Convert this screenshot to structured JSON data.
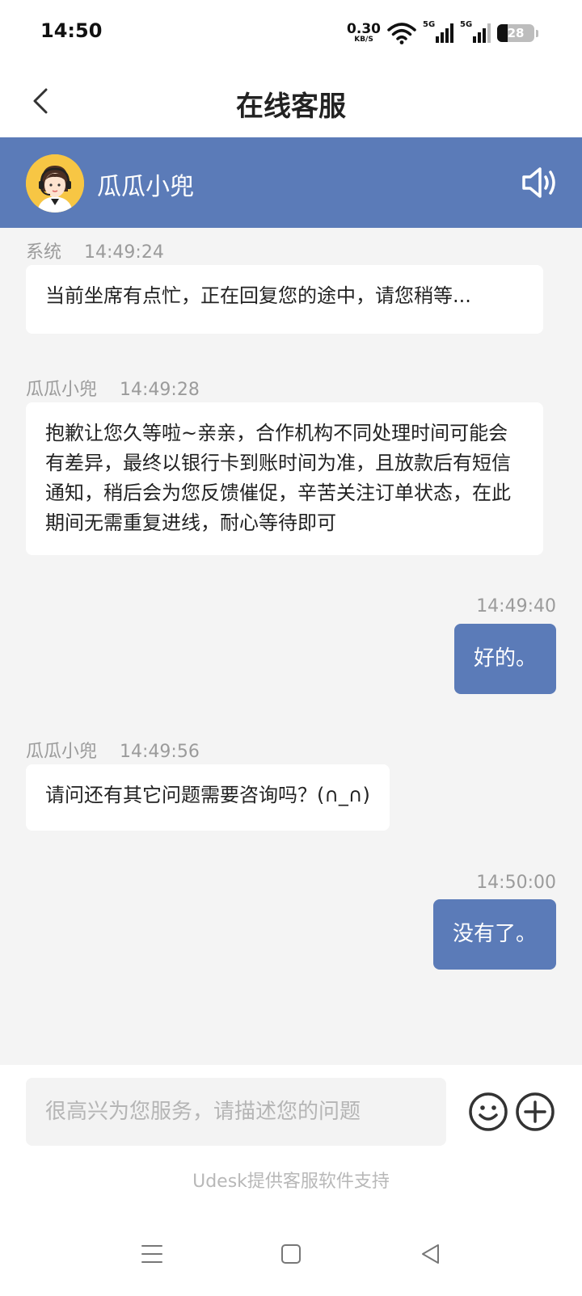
{
  "status_bar": {
    "time": "14:50",
    "net_speed_value": "0.30",
    "net_speed_unit": "KB/S",
    "signal_1_label": "5G",
    "signal_2_label": "5G",
    "battery_level": "28"
  },
  "nav": {
    "title": "在线客服",
    "back_icon": "chevron-left-icon"
  },
  "agent": {
    "name": "瓜瓜小兜",
    "avatar_icon": "agent-avatar",
    "speaker_icon": "speaker-icon"
  },
  "messages": [
    {
      "sender": "系统",
      "time": "14:49:24",
      "text": "当前坐席有点忙，正在回复您的途中，请您稍等..."
    },
    {
      "sender": "瓜瓜小兜",
      "time": "14:49:28",
      "text": "抱歉让您久等啦~亲亲，合作机构不同处理时间可能会有差异，最终以银行卡到账时间为准，且放款后有短信通知，稍后会为您反馈催促，辛苦关注订单状态，在此期间无需重复进线，耐心等待即可"
    },
    {
      "sender": "",
      "time": "14:49:40",
      "text": "好的。"
    },
    {
      "sender": "瓜瓜小兜",
      "time": "14:49:56",
      "text": "请问还有其它问题需要咨询吗？(∩_∩)"
    },
    {
      "sender": "",
      "time": "14:50:00",
      "text": "没有了。"
    }
  ],
  "input": {
    "placeholder": "很高兴为您服务，请描述您的问题",
    "value": "",
    "emoji_icon": "emoji-icon",
    "plus_icon": "plus-circle-icon"
  },
  "footer": {
    "powered_by": "Udesk提供客服软件支持"
  },
  "colors": {
    "accent": "#5b7bb8",
    "chat_bg": "#f4f4f4",
    "meta_text": "#9b9b9b"
  }
}
